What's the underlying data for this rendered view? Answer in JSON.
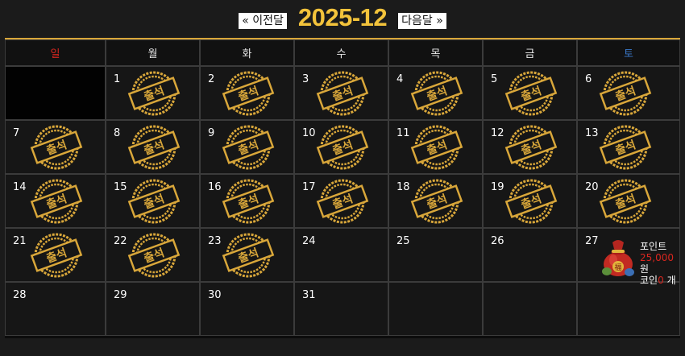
{
  "nav": {
    "prev_label": "« 이전달",
    "next_label": "다음달 »",
    "title": "2025-12"
  },
  "colors": {
    "accent": "#f3c33b",
    "sunday": "#d8261f",
    "saturday": "#3a78c9",
    "stamp": "#d9a73a"
  },
  "weekdays": [
    "일",
    "월",
    "화",
    "수",
    "목",
    "금",
    "토"
  ],
  "stamp_label": "출석",
  "weeks": [
    [
      {
        "day": "",
        "attended": false
      },
      {
        "day": "1",
        "attended": true
      },
      {
        "day": "2",
        "attended": true
      },
      {
        "day": "3",
        "attended": true
      },
      {
        "day": "4",
        "attended": true
      },
      {
        "day": "5",
        "attended": true
      },
      {
        "day": "6",
        "attended": true
      }
    ],
    [
      {
        "day": "7",
        "attended": true
      },
      {
        "day": "8",
        "attended": true
      },
      {
        "day": "9",
        "attended": true
      },
      {
        "day": "10",
        "attended": true
      },
      {
        "day": "11",
        "attended": true
      },
      {
        "day": "12",
        "attended": true
      },
      {
        "day": "13",
        "attended": true
      }
    ],
    [
      {
        "day": "14",
        "attended": true
      },
      {
        "day": "15",
        "attended": true
      },
      {
        "day": "16",
        "attended": true
      },
      {
        "day": "17",
        "attended": true
      },
      {
        "day": "18",
        "attended": true
      },
      {
        "day": "19",
        "attended": true
      },
      {
        "day": "20",
        "attended": true
      }
    ],
    [
      {
        "day": "21",
        "attended": true
      },
      {
        "day": "22",
        "attended": true
      },
      {
        "day": "23",
        "attended": true
      },
      {
        "day": "24",
        "attended": false
      },
      {
        "day": "25",
        "attended": false
      },
      {
        "day": "26",
        "attended": false
      },
      {
        "day": "27",
        "attended": false
      }
    ],
    [
      {
        "day": "28",
        "attended": false
      },
      {
        "day": "29",
        "attended": false
      },
      {
        "day": "30",
        "attended": false
      },
      {
        "day": "31",
        "attended": false
      },
      {
        "day": "",
        "attended": false
      },
      {
        "day": "",
        "attended": false
      },
      {
        "day": "",
        "attended": false
      }
    ]
  ],
  "reward": {
    "icon": "lucky-bag-icon",
    "point_label": "포인트",
    "point_value": "25,000",
    "point_unit": "원",
    "coin_label": "코인",
    "coin_value": "0",
    "coin_unit": "개"
  }
}
